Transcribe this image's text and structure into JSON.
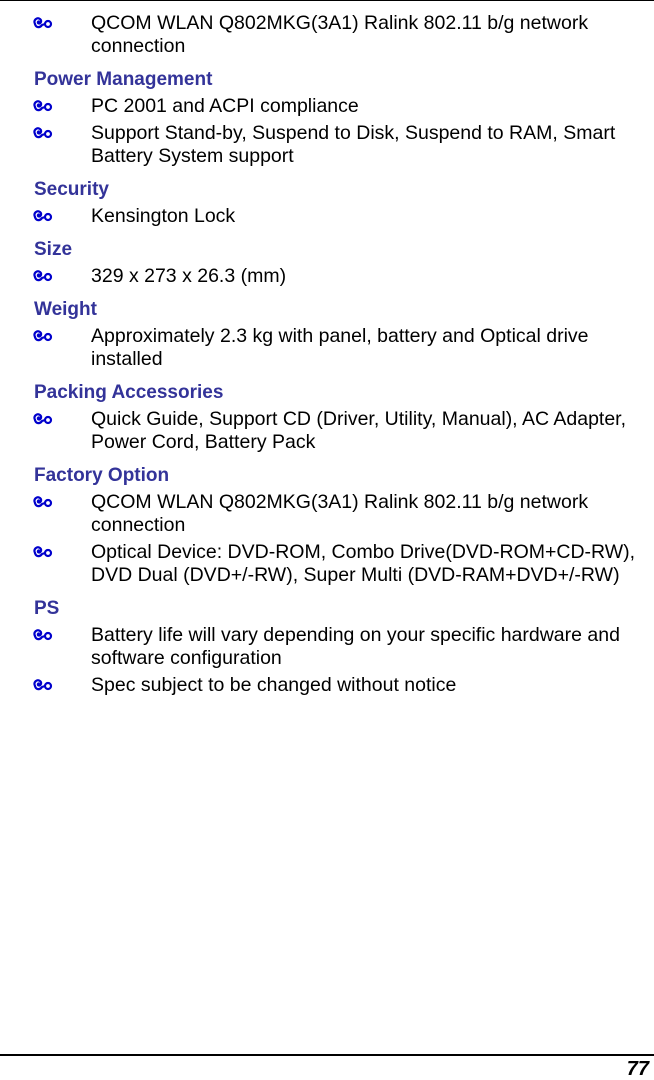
{
  "colors": {
    "heading": "#333399",
    "bullet": "#0000cc",
    "text": "#000000"
  },
  "bullet_icon": "hand-pointer-swirl-icon",
  "sections": [
    {
      "heading": null,
      "items": [
        "QCOM WLAN Q802MKG(3A1) Ralink 802.11 b/g network connection"
      ]
    },
    {
      "heading": "Power Management",
      "items": [
        "PC 2001 and ACPI compliance",
        "Support Stand-by, Suspend to Disk, Suspend to RAM, Smart Battery System support"
      ]
    },
    {
      "heading": "Security",
      "items": [
        "Kensington Lock"
      ]
    },
    {
      "heading": "Size",
      "items": [
        "329 x 273 x 26.3 (mm)"
      ]
    },
    {
      "heading": "Weight",
      "items": [
        "Approximately 2.3 kg with panel, battery and Optical drive installed"
      ]
    },
    {
      "heading": "Packing Accessories",
      "items": [
        "Quick Guide, Support CD (Driver, Utility, Manual), AC Adapter, Power Cord, Battery Pack"
      ]
    },
    {
      "heading": "Factory Option",
      "items": [
        "QCOM WLAN Q802MKG(3A1) Ralink 802.11 b/g network connection",
        "Optical Device: DVD-ROM, Combo Drive(DVD-ROM+CD-RW), DVD Dual (DVD+/-RW), Super Multi (DVD-RAM+DVD+/-RW)"
      ]
    },
    {
      "heading": "PS",
      "items": [
        "Battery life will vary depending on your specific hardware and software configuration",
        "Spec subject to be changed without notice"
      ]
    }
  ],
  "footer": {
    "page_number": "77"
  }
}
